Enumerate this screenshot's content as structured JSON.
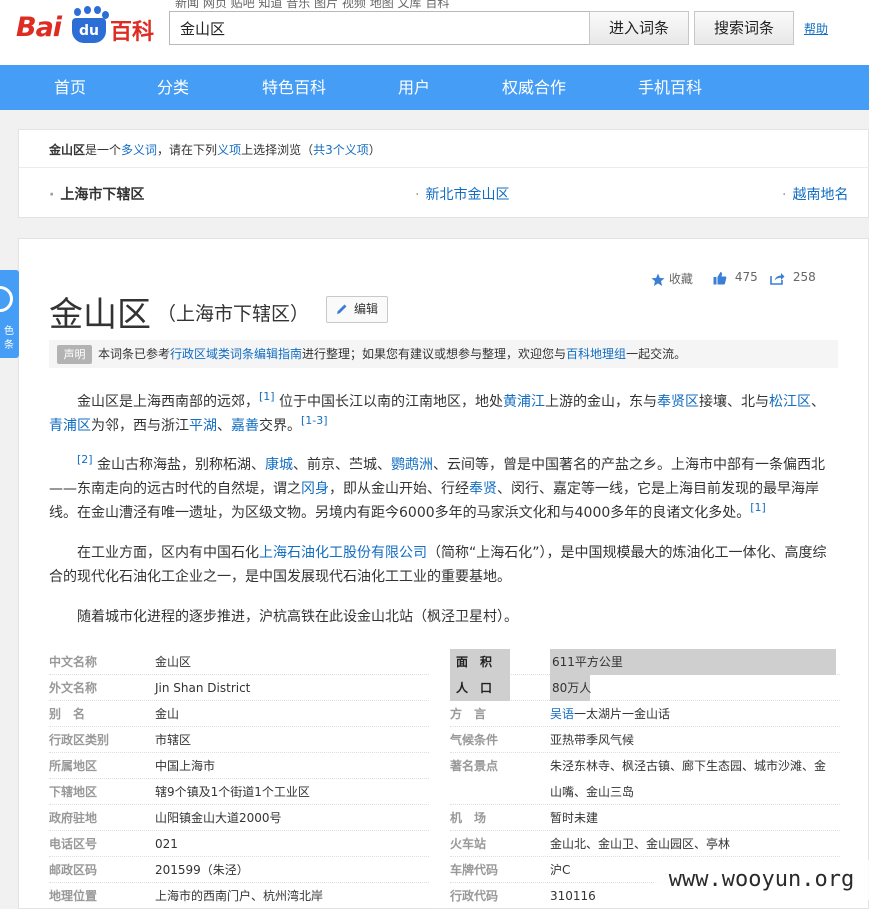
{
  "header": {
    "logo_text_bai": "Bai",
    "logo_text_du": "du",
    "logo_text_baike": "百科",
    "faded_top_text": "新闻 网页 贴吧 知道 音乐 图片 视频 地图 文库 百科",
    "search_value": "金山区",
    "enter_button": "进入词条",
    "search_button": "搜索词条",
    "help_link": "帮助"
  },
  "nav": {
    "items": [
      "首页",
      "分类",
      "特色百科",
      "用户",
      "权威合作",
      "手机百科"
    ]
  },
  "disambiguation": {
    "term": "金山区",
    "text_1": "是一个",
    "link_1": "多义词",
    "text_2": "，请在下列",
    "link_2": "义项",
    "text_3": "上选择浏览（",
    "link_3": "共3个义项",
    "text_4": "）",
    "options": [
      "上海市下辖区",
      "新北市金山区",
      "越南地名"
    ]
  },
  "side_tab": {
    "line_1": "色",
    "line_2": "条"
  },
  "actions": {
    "favorite": "收藏",
    "likes": "475",
    "shares": "258"
  },
  "entry": {
    "title": "金山区",
    "subtitle": "（上海市下辖区）",
    "edit_button": "编辑"
  },
  "notice": {
    "tag": "声明",
    "text_1": "本词条已参考",
    "link_1": "行政区域类词条编辑指南",
    "text_2": "进行整理；如果您有建议或想参与整理，欢迎您与",
    "link_2": "百科地理组",
    "text_3": "一起交流。"
  },
  "paragraphs": {
    "p1": {
      "a": "金山区是上海西南部的远郊，",
      "ref1": "[1]",
      "b": " 位于中国长江以南的江南地区，地处",
      "l1": "黄浦江",
      "c": "上游的金山，东与",
      "l2": "奉贤区",
      "d": "接壤、北与",
      "l3": "松江区",
      "e": "、",
      "l4": "青浦区",
      "f": "为邻，西与浙江",
      "l5": "平湖",
      "g": "、",
      "l6": "嘉善",
      "h": "交界。",
      "ref2": "[1-3]"
    },
    "p2": {
      "ref1": "[2]",
      "a": " 金山古称海盐，别称柘湖、",
      "l1": "康城",
      "b": "、前京、苎城、",
      "l2": "鹦鹉洲",
      "c": "、云间等，曾是中国著名的产盐之乡。上海市中部有一条偏西北——东南走向的远古时代的自然堤，谓之",
      "l3": "冈身",
      "d": "，即从金山开始、行经",
      "l4": "奉贤",
      "e": "、闵行、嘉定等一线，它是上海目前发现的最早海岸线。在金山漕泾有唯一遗址，为区级文物。另境内有距今6000多年的马家浜文化和与4000多年的良诸文化多处。",
      "ref2": "[1]"
    },
    "p3": {
      "a": "在工业方面，区内有中国石化",
      "l1": "上海石油化工股份有限公司",
      "b": "（简称“上海石化”），是中国规模最大的炼油化工一体化、高度综合的现代化石油化工企业之一，是中国发展现代石油化工工业的重要基地。"
    },
    "p4": {
      "a": "随着城市化进程的逐步推进，沪杭高铁在此设金山北站（枫泾卫星村）。"
    }
  },
  "info_left": [
    {
      "key": "中文名称",
      "value": "金山区"
    },
    {
      "key": "外文名称",
      "value": "Jin Shan District"
    },
    {
      "key": "别　名",
      "value": "金山"
    },
    {
      "key": "行政区类别",
      "value": "市辖区"
    },
    {
      "key": "所属地区",
      "value": "中国上海市"
    },
    {
      "key": "下辖地区",
      "value": "辖9个镇及1个街道1个工业区"
    },
    {
      "key": "政府驻地",
      "value": "山阳镇金山大道2000号"
    },
    {
      "key": "电话区号",
      "value": "021"
    },
    {
      "key": "邮政区码",
      "value": "201599（朱泾）"
    },
    {
      "key": "地理位置",
      "value": "上海市的西南门户、杭州湾北岸"
    }
  ],
  "info_right": [
    {
      "key": "面　积",
      "value": "611平方公里"
    },
    {
      "key": "人　口",
      "value": "80万人"
    },
    {
      "key": "方　言",
      "value_link": "吴语",
      "value": "一太湖片一金山话"
    },
    {
      "key": "气候条件",
      "value": "亚热带季风气候"
    },
    {
      "key": "著名景点",
      "value": "朱泾东林寺、枫泾古镇、廊下生态园、城市沙滩、金"
    },
    {
      "key": "",
      "value": "山嘴、金山三岛"
    },
    {
      "key": "机　场",
      "value": "暂时未建"
    },
    {
      "key": "火车站",
      "value": "金山北、金山卫、金山园区、亭林"
    },
    {
      "key": "车牌代码",
      "value": "沪C"
    },
    {
      "key": "行政代码",
      "value": "310116"
    }
  ],
  "watermark": "www.wooyun.org",
  "colors": {
    "nav_bg": "#459df5",
    "link": "#136ec2",
    "logo_red": "#de2c23",
    "logo_blue": "#2d6dd6"
  }
}
